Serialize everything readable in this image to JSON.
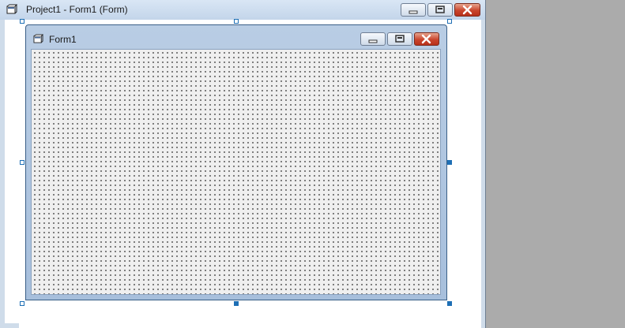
{
  "outer_window": {
    "title": "Project1 - Form1 (Form)",
    "icon": "form-window-icon",
    "buttons": {
      "minimize": "minimize-icon",
      "maximize": "maximize-icon",
      "close": "close-icon"
    }
  },
  "form_window": {
    "title": "Form1",
    "icon": "form-window-icon",
    "buttons": {
      "minimize": "minimize-icon",
      "maximize": "maximize-icon",
      "close": "close-icon"
    }
  },
  "colors": {
    "desktop": "#ababab",
    "caption": "#c3d5ea",
    "close_button": "#c9452d",
    "selection_handle": "#1e6fb5",
    "form_background": "#efefef"
  }
}
